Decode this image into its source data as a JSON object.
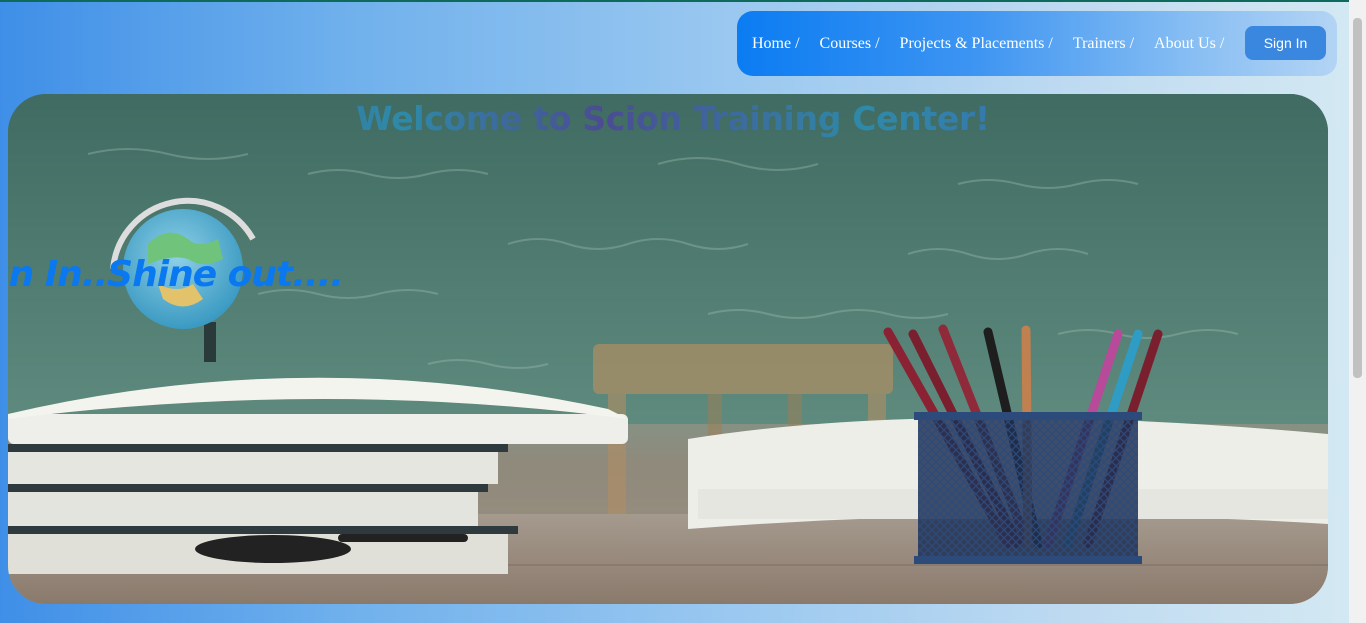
{
  "nav": {
    "links": [
      "Home /",
      "Courses /",
      "Projects & Placements /",
      "Trainers /",
      "About Us /"
    ],
    "signin_label": "Sign In"
  },
  "hero": {
    "title": "Welcome to Scion Training Center!",
    "tagline": "un In..Shine out...."
  },
  "colors": {
    "nav_bg": "#0b7cf2",
    "signin_bg": "#3a87e0",
    "tagline": "#0a78f0",
    "title_a": "#4b4b94",
    "title_b": "#2e8aa8"
  }
}
